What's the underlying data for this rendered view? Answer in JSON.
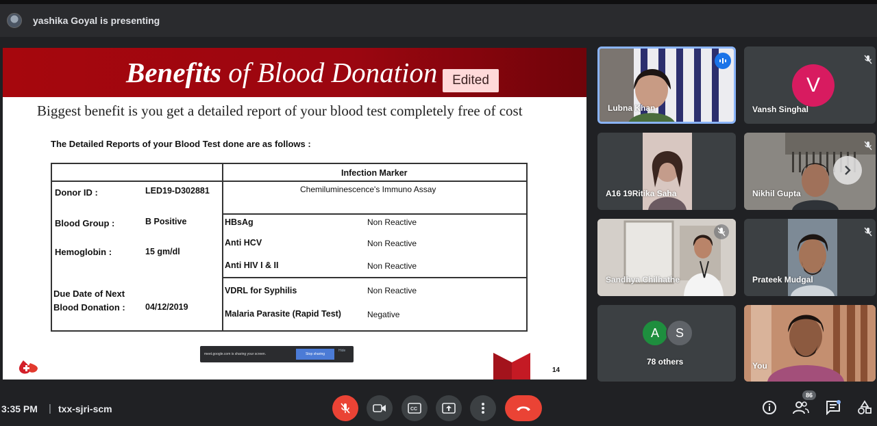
{
  "presenter": {
    "text": "yashika Goyal is presenting"
  },
  "slide": {
    "title_bold": "Benefits",
    "title_rest": " of Blood Donation",
    "edited_label": "Edited",
    "subtitle": "Biggest benefit is you get a detailed report of your blood test completely free of cost",
    "report_heading": "The Detailed Reports of your Blood Test done are as follows :",
    "table": {
      "header_right": "Infection Marker",
      "method": "Chemiluminescence's Immuno Assay",
      "left_rows": [
        {
          "label": "Donor ID :",
          "value": "LED19-D302881"
        },
        {
          "label": "Blood Group :",
          "value": "B Positive"
        },
        {
          "label": "Hemoglobin :",
          "value": "15 gm/dl"
        },
        {
          "label": "Due Date of Next",
          "label2": "Blood Donation :",
          "value": "04/12/2019"
        }
      ],
      "tests": [
        {
          "name": "HBsAg",
          "result": "Non Reactive"
        },
        {
          "name": "Anti HCV",
          "result": "Non Reactive"
        },
        {
          "name": "Anti HIV I & II",
          "result": "Non Reactive"
        },
        {
          "name": "VDRL   for Syphilis",
          "result": "Non Reactive"
        },
        {
          "name": "Malaria Parasite (Rapid Test)",
          "result": "Negative"
        }
      ]
    },
    "toast_text": "meet.google.com is sharing your screen.",
    "toast_button": "Stop sharing",
    "toast_hide": "Hide",
    "page_number": "14"
  },
  "participants": [
    {
      "name": "Lubna Khan",
      "speaking": true
    },
    {
      "name": "Vansh Singhal",
      "initial": "V",
      "avatar_color": "#d81b60"
    },
    {
      "name": "A16 19Ritika Saha"
    },
    {
      "name": "Nikhil Gupta"
    },
    {
      "name": "Sandhya Chilhathe"
    },
    {
      "name": "Prateek Mudgal"
    },
    {
      "name": "78 others",
      "initials": [
        "A",
        "S"
      ],
      "avatar_colors": [
        "#1e8e3e",
        "#5f6368"
      ]
    },
    {
      "name": "You"
    }
  ],
  "meeting": {
    "time": "3:35 PM",
    "separator": "|",
    "code": "txx-sjri-scm",
    "participant_count": "86"
  },
  "colors": {
    "slide_header": "#a6070d",
    "leave_red": "#ea4335",
    "speaking_blue": "#1a73e8",
    "tile_bg": "#3c4043"
  }
}
